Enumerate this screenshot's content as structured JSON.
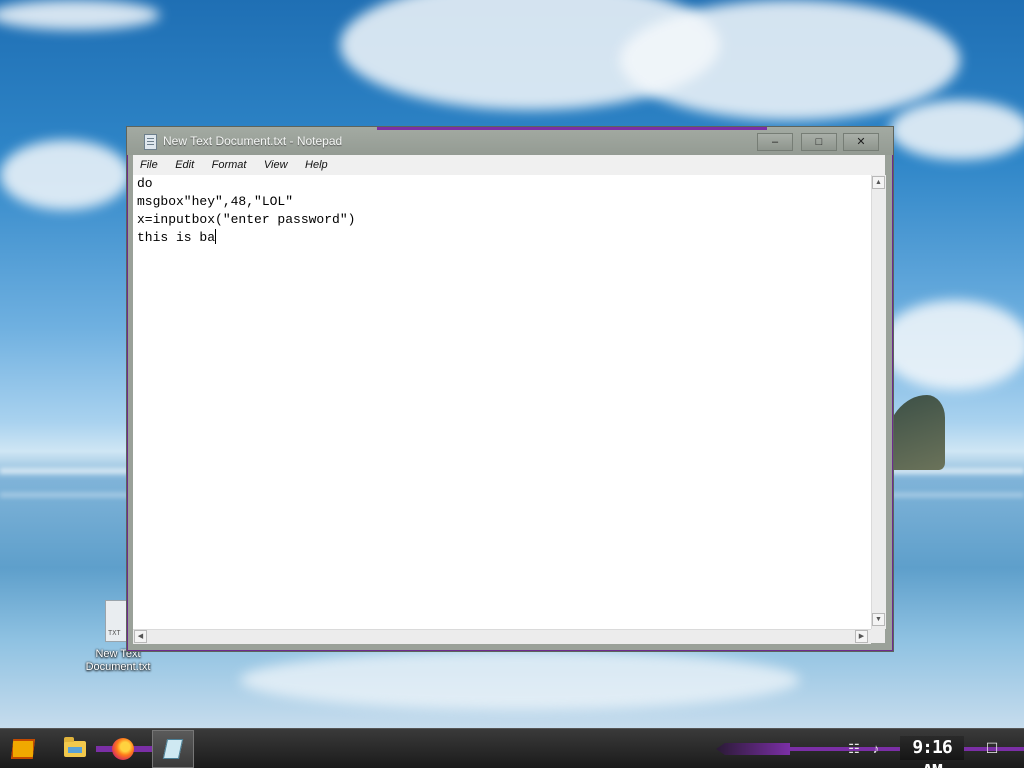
{
  "desktop": {
    "icons": [
      {
        "label_line1": "New Text",
        "label_line2": "Document.txt",
        "thumb_text": "TXT"
      }
    ]
  },
  "window": {
    "title": "New Text Document.txt - Notepad",
    "buttons": {
      "minimize": "–",
      "maximize": "□",
      "close": "✕"
    },
    "menu": [
      "File",
      "Edit",
      "Format",
      "View",
      "Help"
    ],
    "content_lines": [
      "do",
      "msgbox\"hey\",48,\"LOL\"",
      "x=inputbox(\"enter password\")",
      "this is ba"
    ],
    "scroll_arrows": {
      "up": "▲",
      "down": "▼",
      "left": "◀",
      "right": "▶"
    }
  },
  "taskbar": {
    "pinned_icons": [
      "start-icon",
      "file-explorer-icon",
      "firefox-icon",
      "notepad-icon"
    ],
    "tray": {
      "network_icon": "☷",
      "volume_icon": "♪"
    },
    "clock": "9:16 AM",
    "notification_icon": "☐",
    "accent_color": "#7b2fa6"
  }
}
